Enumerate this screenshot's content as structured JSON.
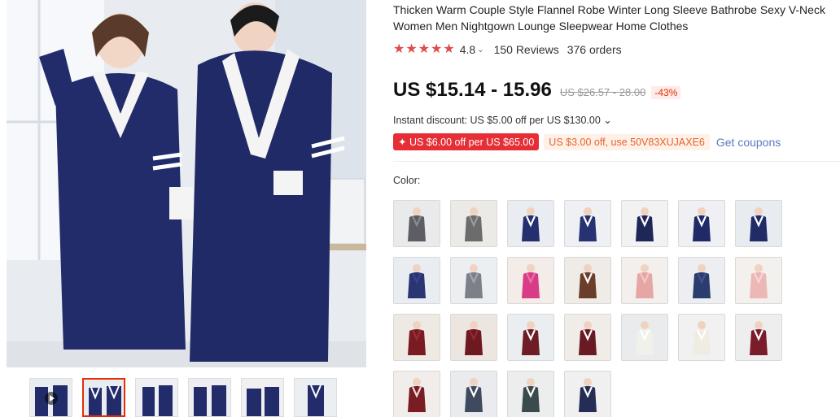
{
  "product": {
    "title": "Thicken Warm Couple Style Flannel Robe Winter Long Sleeve Bathrobe Sexy V-Neck Women Men Nightgown Lounge Sleepwear Home Clothes",
    "rating": "4.8",
    "rating_chevron": "⌄",
    "reviews": "150 Reviews",
    "orders": "376 orders",
    "price": "US $15.14 - 15.96",
    "original_price": "US $26.57 - 28.00",
    "discount": "-43%",
    "instant_discount": "Instant discount: US $5.00 off per US $130.00 ⌄",
    "coupon_primary": "✦ US $6.00 off per US $65.00",
    "coupon_secondary": "US $3.00 off, use 50V83XUJAXE6",
    "get_coupons": "Get coupons",
    "color_label": "Color:"
  },
  "colors": {
    "star": "#e14b4b",
    "price": "#111111",
    "accent_red": "#e62e37",
    "coupon_orange": "#e8612c",
    "link_blue": "#5a7bbf"
  },
  "swatches": [
    {
      "robe": "#5d5d63",
      "trim": "#8a8a90",
      "bg": "#e8eaec"
    },
    {
      "robe": "#6c6c6c",
      "trim": "#9a9a9a",
      "bg": "#eceae6"
    },
    {
      "robe": "#24306e",
      "trim": "#ffffff",
      "bg": "#e9edf2"
    },
    {
      "robe": "#263271",
      "trim": "#ffffff",
      "bg": "#eef0f3"
    },
    {
      "robe": "#1e2758",
      "trim": "#ffffff",
      "bg": "#f2f2f2"
    },
    {
      "robe": "#1f2a66",
      "trim": "#ffffff",
      "bg": "#eef0f4"
    },
    {
      "robe": "#202b68",
      "trim": "#ffffff",
      "bg": "#e8ecf0"
    },
    {
      "robe": "#2a3574",
      "trim": "#3a4486",
      "bg": "#e9edf1"
    },
    {
      "robe": "#7c8088",
      "trim": "#a0a4ab",
      "bg": "#eceff1"
    },
    {
      "robe": "#d93c86",
      "trim": "#e873a8",
      "bg": "#f3ece8"
    },
    {
      "robe": "#6b3e2c",
      "trim": "#ffffff",
      "bg": "#efebe6"
    },
    {
      "robe": "#e6a7a4",
      "trim": "#f2c8c5",
      "bg": "#f2efec"
    },
    {
      "robe": "#2b3d6e",
      "trim": "#40528a",
      "bg": "#eceef1"
    },
    {
      "robe": "#ebb8b6",
      "trim": "#f5d7d5",
      "bg": "#f3f0ee"
    },
    {
      "robe": "#7a1b24",
      "trim": "#9b2b35",
      "bg": "#efe9e4"
    },
    {
      "robe": "#6e1820",
      "trim": "#8e2a33",
      "bg": "#ede6e0"
    },
    {
      "robe": "#6e1c25",
      "trim": "#ffffff",
      "bg": "#ebeef1"
    },
    {
      "robe": "#6a1a22",
      "trim": "#ffffff",
      "bg": "#f0ece8"
    },
    {
      "robe": "#f1f1ec",
      "trim": "#ffffff",
      "bg": "#e9ebec"
    },
    {
      "robe": "#efece4",
      "trim": "#ffffff",
      "bg": "#f1f1f1"
    },
    {
      "robe": "#7b1c2a",
      "trim": "#ffffff",
      "bg": "#eeeeef"
    },
    {
      "robe": "#7a1c24",
      "trim": "#f0d8dc",
      "bg": "#f1edea"
    },
    {
      "robe": "#3f4a5e",
      "trim": "#ffffff",
      "bg": "#e9ebee"
    },
    {
      "robe": "#3b4a4c",
      "trim": "#ffffff",
      "bg": "#eceeee"
    },
    {
      "robe": "#252c56",
      "trim": "#ffffff",
      "bg": "#f0f0f0"
    }
  ],
  "thumbs": [
    {
      "robe": "#232c6b",
      "video": true
    },
    {
      "robe": "#232c6b",
      "video": false
    },
    {
      "robe": "#232c6b",
      "video": false
    },
    {
      "robe": "#232c6b",
      "video": false
    },
    {
      "robe": "#232c6b",
      "video": false
    },
    {
      "robe": "#232c6b",
      "video": false
    }
  ]
}
